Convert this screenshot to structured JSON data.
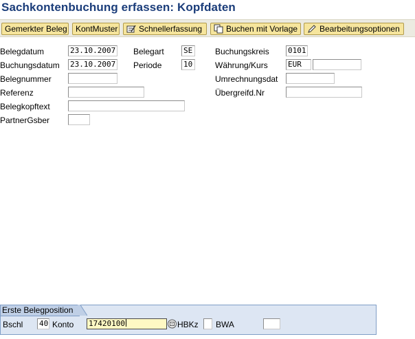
{
  "window": {
    "title": "Sachkontenbuchung erfassen: Kopfdaten"
  },
  "toolbar": {
    "buttons": [
      {
        "label": "Gemerkter Beleg",
        "icon": ""
      },
      {
        "label": "KontMuster",
        "icon": ""
      },
      {
        "label": "Schnellerfassung",
        "icon": "fast-entry-icon"
      },
      {
        "label": "Buchen mit Vorlage",
        "icon": "copy-icon"
      },
      {
        "label": "Bearbeitungsoptionen",
        "icon": "pencil-icon"
      }
    ]
  },
  "header": {
    "belegdatum": {
      "label": "Belegdatum",
      "value": "23.10.2007"
    },
    "buchungsdatum": {
      "label": "Buchungsdatum",
      "value": "23.10.2007"
    },
    "belegnummer": {
      "label": "Belegnummer",
      "value": ""
    },
    "referenz": {
      "label": "Referenz",
      "value": ""
    },
    "belegkopftext": {
      "label": "Belegkopftext",
      "value": ""
    },
    "partnergsber": {
      "label": "PartnerGsber",
      "value": ""
    },
    "belegart": {
      "label": "Belegart",
      "value": "SE"
    },
    "periode": {
      "label": "Periode",
      "value": "10"
    },
    "buchungskreis": {
      "label": "Buchungskreis",
      "value": "0101"
    },
    "waehrung": {
      "label": "Währung/Kurs",
      "value": "EUR",
      "rate": ""
    },
    "umrechnungsdat": {
      "label": "Umrechnungsdat",
      "value": ""
    },
    "uebergreifd": {
      "label": "Übergreifd.Nr",
      "value": ""
    }
  },
  "first_item": {
    "tab_label": "Erste Belegposition",
    "bschl": {
      "label": "Bschl",
      "value": "40"
    },
    "konto": {
      "label": "Konto",
      "value": "17420100"
    },
    "hbkz": {
      "label": "HBKz",
      "value": ""
    },
    "bwa": {
      "label": "BWA",
      "value": ""
    }
  },
  "colors": {
    "title": "#1b3d7a",
    "button_bg": "#f6e59c",
    "panel_bg": "#dde6f3",
    "active_field": "#fff9c4"
  }
}
